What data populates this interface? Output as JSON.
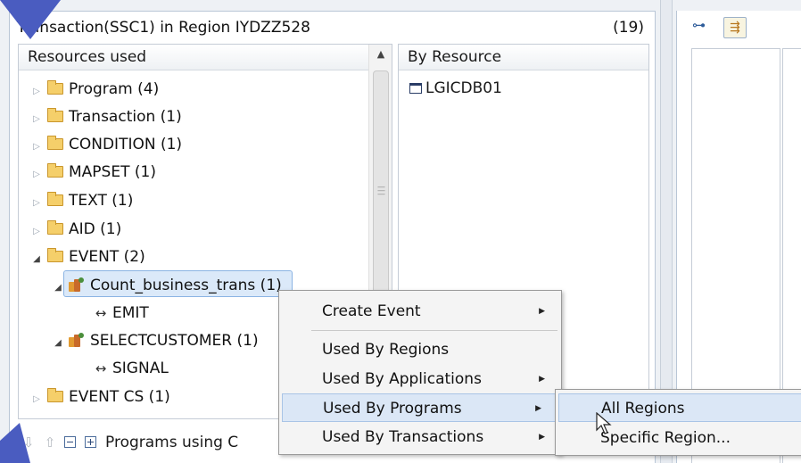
{
  "window": {
    "title": "Transaction(SSC1) in Region IYDZZ528",
    "count": "(19)"
  },
  "resources_panel": {
    "header": "Resources used",
    "items": [
      {
        "label": "Program  (4)",
        "expanded": false,
        "icon": "folder-icon"
      },
      {
        "label": "Transaction  (1)",
        "expanded": false,
        "icon": "folder-icon"
      },
      {
        "label": "CONDITION  (1)",
        "expanded": false,
        "icon": "folder-icon"
      },
      {
        "label": "MAPSET  (1)",
        "expanded": false,
        "icon": "folder-icon"
      },
      {
        "label": "TEXT  (1)",
        "expanded": false,
        "icon": "folder-icon"
      },
      {
        "label": "AID  (1)",
        "expanded": false,
        "icon": "folder-icon"
      },
      {
        "label": "EVENT  (2)",
        "expanded": true,
        "icon": "folder-icon"
      },
      {
        "label": "Count_business_trans (1)",
        "expanded": true,
        "icon": "event-icon",
        "selected": true
      },
      {
        "label": "EMIT",
        "icon": "arrow-icon"
      },
      {
        "label": "SELECTCUSTOMER (1)",
        "expanded": true,
        "icon": "event-icon"
      },
      {
        "label": "SIGNAL",
        "icon": "arrow-icon"
      },
      {
        "label": "EVENT CS  (1)",
        "expanded": false,
        "icon": "folder-icon"
      }
    ]
  },
  "by_resource_panel": {
    "header": "By Resource",
    "item": "LGICDB01"
  },
  "bottom_bar": {
    "label": "Programs using C"
  },
  "context_menu": {
    "items": [
      {
        "label": "Create Event",
        "has_submenu": true
      },
      {
        "label": "Used By Regions",
        "has_submenu": false
      },
      {
        "label": "Used By Applications",
        "has_submenu": true
      },
      {
        "label": "Used By Programs",
        "has_submenu": true,
        "highlighted": true
      },
      {
        "label": "Used By Transactions",
        "has_submenu": true
      }
    ]
  },
  "submenu": {
    "items": [
      {
        "label": "All Regions",
        "highlighted": true
      },
      {
        "label": "Specific Region..."
      }
    ]
  },
  "colors": {
    "selection": "#dbe9f9",
    "menu_highlight": "#dbe7f6",
    "folder": "#f5cf6a",
    "corner_accent": "#4a5cc0"
  }
}
